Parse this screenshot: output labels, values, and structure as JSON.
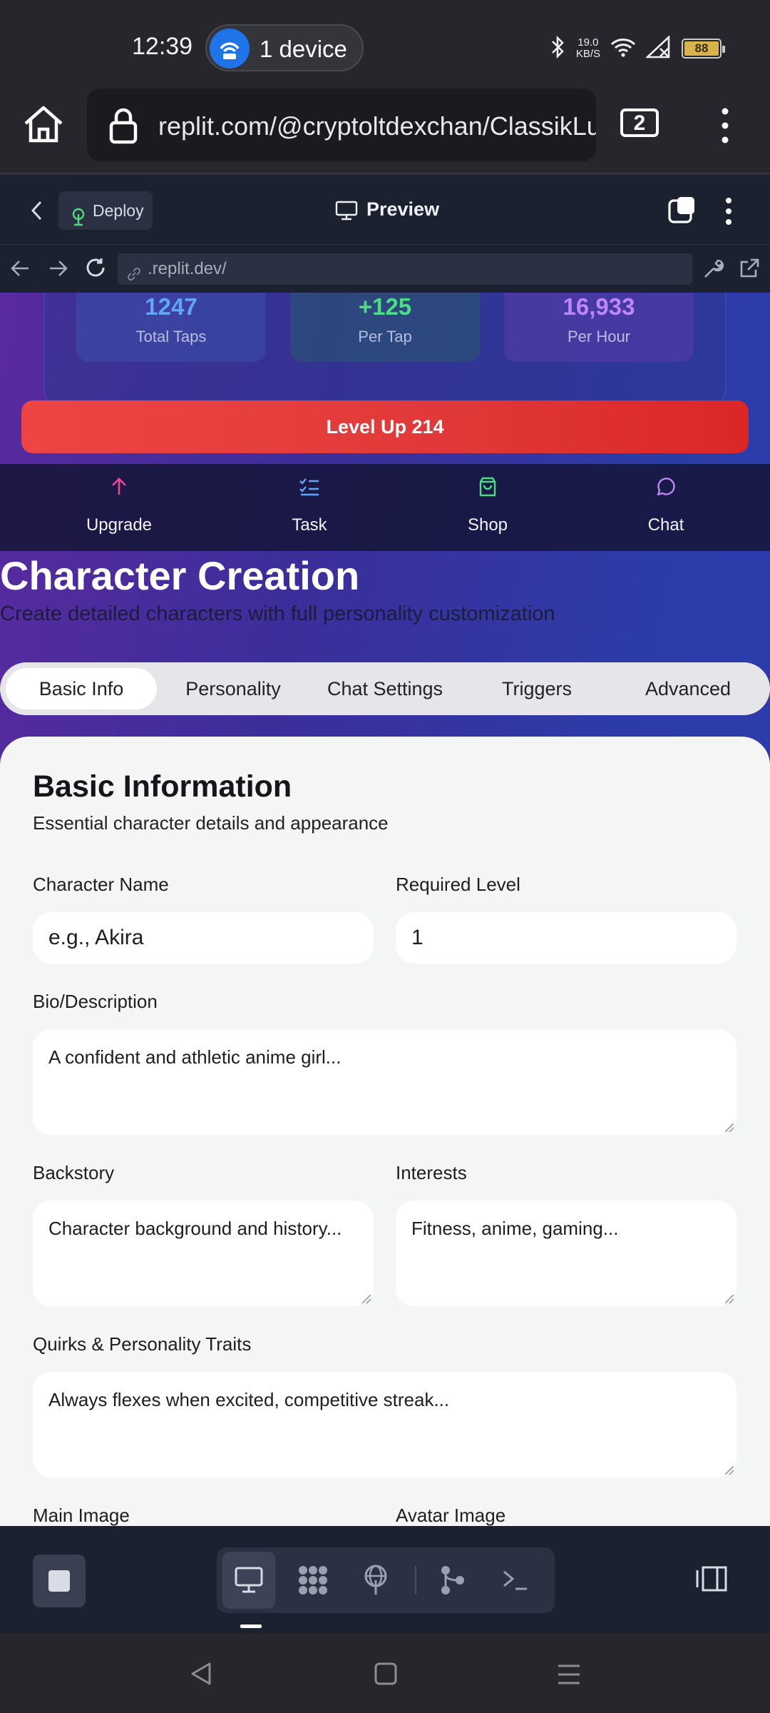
{
  "status_bar": {
    "time": "12:39",
    "hotspot_label": "1 device",
    "network_speed": "19.0",
    "network_unit": "KB/S",
    "battery": "88"
  },
  "browser": {
    "url": "replit.com/@cryptoltdexchan/ClassikLust",
    "tab_count": "2"
  },
  "replit_header": {
    "deploy_label": "Deploy",
    "preview_label": "Preview",
    "address": ".replit.dev/"
  },
  "stats": {
    "total_taps_value": "1247",
    "total_taps_label": "Total Taps",
    "per_tap_value": "+125",
    "per_tap_label": "Per Tap",
    "per_hour_value": "16,933",
    "per_hour_label": "Per Hour",
    "colors": {
      "taps": "#60a5fa",
      "per_tap": "#4ade80",
      "per_hour": "#c084fc"
    }
  },
  "level_up_label": "Level Up  214",
  "nav": [
    {
      "label": "Upgrade",
      "icon": "arrow-up-icon",
      "color": "#ec4899"
    },
    {
      "label": "Task",
      "icon": "checklist-icon",
      "color": "#60a5fa"
    },
    {
      "label": "Shop",
      "icon": "shopping-bag-icon",
      "color": "#4ade80"
    },
    {
      "label": "Chat",
      "icon": "message-circle-icon",
      "color": "#c084fc"
    }
  ],
  "page": {
    "title": "Character Creation",
    "subtitle": "Create detailed characters with full personality customization"
  },
  "tabs": [
    "Basic Info",
    "Personality",
    "Chat Settings",
    "Triggers",
    "Advanced"
  ],
  "active_tab": "Basic Info",
  "form": {
    "heading": "Basic Information",
    "description": "Essential character details and appearance",
    "character_name_label": "Character Name",
    "character_name_placeholder": "e.g., Akira",
    "required_level_label": "Required Level",
    "required_level_value": "1",
    "bio_label": "Bio/Description",
    "bio_placeholder": "A confident and athletic anime girl...",
    "backstory_label": "Backstory",
    "backstory_placeholder": "Character background and history...",
    "interests_label": "Interests",
    "interests_placeholder": "Fitness, anime, gaming...",
    "quirks_label": "Quirks & Personality Traits",
    "quirks_placeholder": "Always flexes when excited, competitive streak...",
    "main_image_label": "Main Image",
    "avatar_image_label": "Avatar Image"
  }
}
